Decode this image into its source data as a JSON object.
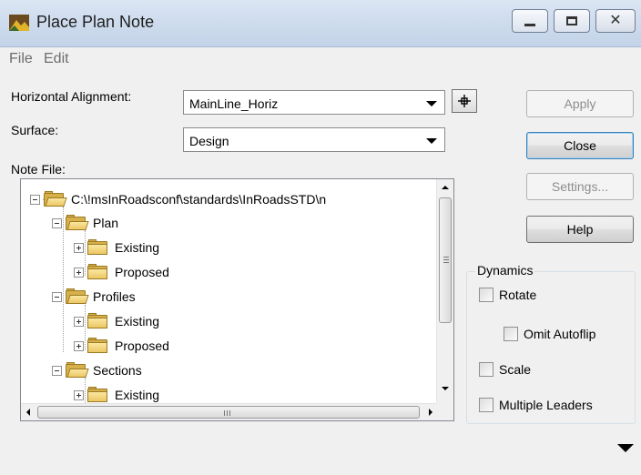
{
  "window": {
    "title": "Place Plan Note"
  },
  "menu": {
    "items": [
      "File",
      "Edit"
    ]
  },
  "form": {
    "horizontal_alignment_label": "Horizontal Alignment:",
    "horizontal_alignment_value": "MainLine_Horiz",
    "surface_label": "Surface:",
    "surface_value": "Design",
    "note_file_label": "Note File:"
  },
  "buttons": {
    "apply": "Apply",
    "close": "Close",
    "settings": "Settings...",
    "help": "Help"
  },
  "tree": {
    "root": "C:\\!msInRoadsconf\\standards\\InRoadsSTD\\n",
    "nodes": [
      {
        "label": "Plan"
      },
      {
        "label": "Existing"
      },
      {
        "label": "Proposed"
      },
      {
        "label": "Profiles"
      },
      {
        "label": "Existing"
      },
      {
        "label": "Proposed"
      },
      {
        "label": "Sections"
      },
      {
        "label": "Existing"
      }
    ]
  },
  "dynamics": {
    "title": "Dynamics",
    "rotate": {
      "label": "Rotate",
      "checked": false
    },
    "omit_autoflip": {
      "label": "Omit Autoflip",
      "checked": false
    },
    "scale": {
      "label": "Scale",
      "checked": false
    },
    "multiple_leaders": {
      "label": "Multiple Leaders",
      "checked": false
    }
  },
  "icons": [
    "app-icon",
    "minimize-icon",
    "maximize-icon",
    "close-icon",
    "pick-alignment-icon",
    "folder-icon",
    "expand-icon",
    "collapse-icon",
    "scroll-arrow-icon",
    "collapse-dialog-icon"
  ]
}
